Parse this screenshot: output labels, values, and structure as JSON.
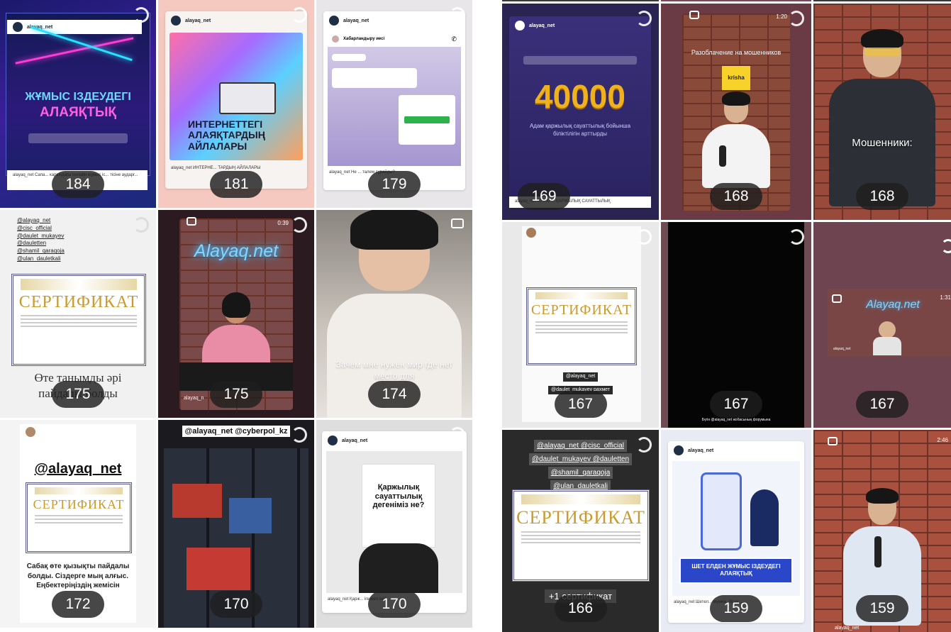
{
  "tiles_left": [
    {
      "count": "184",
      "handle": "alayaq_net",
      "title_line1": "ЖҰМЫС ІЗДЕУДЕГІ",
      "title_line2": "АЛАЯҚТЫҚ",
      "caption": "alayaq_net Сапа... карындағы онлайн жұмыс іс... тісіне аударг..."
    },
    {
      "count": "181",
      "handle": "alayaq_net",
      "title": "ИНТЕРНЕТТЕГІ АЛАЯҚТАРДЫҢ АЙЛАЛАРЫ",
      "caption": "alayaq_net ИНТЕРНЕ... ТАРДЫҢ АЙЛАЛАРЫ"
    },
    {
      "count": "179",
      "handle": "alayaq_net",
      "chat_name": "Хабарландыру иесі",
      "caption": "alayaq_net Не ... талем сұрайды?"
    },
    {
      "count": "175",
      "mentions": [
        "@alayaq_net",
        "@cisc_official",
        "@daulet_mukayev",
        "@dauletten",
        "@shamil_qaraqoja",
        "@ulan_dauletkali"
      ],
      "cert_word": "СЕРТИФИКАТ",
      "text": "Өте танымды әрі пайдалы болды"
    },
    {
      "count": "175",
      "time": "0:39",
      "neon": "Alayaq.net",
      "handle": "alayaq_n"
    },
    {
      "count": "174",
      "text": "Зачем мне нужен мир где нет место для"
    },
    {
      "count": "172",
      "handle": "@alayaq_net",
      "cert_word": "СЕРТИФИКАТ",
      "text": "Сабақ өте қызықты пайдалы болды. Сіздерге мың алғыс. Еңбектеріңіздің жемісін"
    },
    {
      "count": "170",
      "mentions": "@alayaq_net @cyberpol_kz"
    },
    {
      "count": "170",
      "handle": "alayaq_net",
      "title": "Қаржылық сауаттылық дегеніміз не?",
      "caption": "alayaq_net Қарж... ігеніміз не?"
    }
  ],
  "tiles_right": [
    {
      "count": "169",
      "handle": "alayaq_net",
      "big_number": "40000",
      "sub": "Адам қаржылық сауаттылық бойынша біліктілігін арттырды",
      "caption": "alayaq_net 40 000 ... ҚАРЖЫЛЫҚ САУАТТЫЛЫҚ"
    },
    {
      "count": "168",
      "time": "1:20",
      "sign": "krisha",
      "banner": "Разоблачение на мошенников"
    },
    {
      "count": "168",
      "text": "Мошенники:"
    },
    {
      "count": "167",
      "cert_word": "СЕРТИФИКАТ",
      "mentions": [
        "@alayaq_net",
        "@daulet_mukayev рахмет"
      ]
    },
    {
      "count": "167",
      "caption": "Бүгін @alayaq_net жобасының форумына"
    },
    {
      "count": "167",
      "neon": "Alayaq.net",
      "time": "1:31",
      "handle": "alayaq_net"
    },
    {
      "count": "166",
      "mentions": [
        "@alayaq_net @cisc_official",
        "@daulet_mukayev @dauletten",
        "@shamil_qaraqoja",
        "@ulan_dauletkali"
      ],
      "cert_word": "СЕРТИФИКАТ",
      "text": "+1 сертификат"
    },
    {
      "count": "159",
      "handle": "alayaq_net",
      "title": "ШЕТ ЕЛДЕН ЖҰМЫС ІЗДЕУДЕГІ АЛАЯҚТЫҚ",
      "caption": "alayaq_net Шетел... мүмкін, бірақ ..."
    },
    {
      "count": "159",
      "time": "2:46",
      "handle": "alayaq_net"
    }
  ],
  "colors": {
    "accent_gold": "#f0b21c",
    "neon_blue": "#2aa8ff",
    "badge_bg": "#1e1e1e"
  }
}
